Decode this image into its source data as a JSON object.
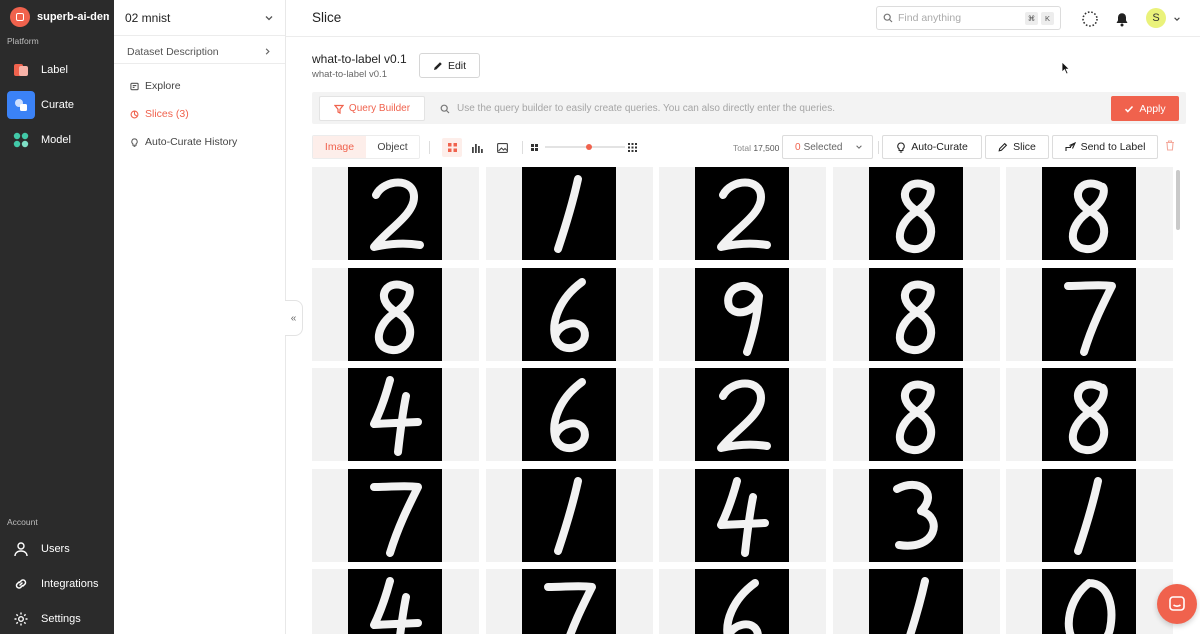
{
  "workspace": {
    "name": "superb-ai-demo"
  },
  "sidebar": {
    "platform_label": "Platform",
    "account_label": "Account",
    "platform_items": [
      {
        "label": "Label",
        "icon": "label-icon"
      },
      {
        "label": "Curate",
        "icon": "curate-icon",
        "active": true
      },
      {
        "label": "Model",
        "icon": "model-icon"
      }
    ],
    "account_items": [
      {
        "label": "Users",
        "icon": "user-icon"
      },
      {
        "label": "Integrations",
        "icon": "link-icon"
      },
      {
        "label": "Settings",
        "icon": "gear-icon"
      }
    ]
  },
  "subnav": {
    "project": "02 mnist",
    "dataset_description": "Dataset Description",
    "items": [
      {
        "label": "Explore",
        "icon": "explore-icon"
      },
      {
        "label": "Slices (3)",
        "icon": "slices-icon",
        "active": true
      },
      {
        "label": "Auto-Curate History",
        "icon": "bulb-icon"
      }
    ],
    "collapse_glyph": "«"
  },
  "header": {
    "title": "Slice",
    "search_placeholder": "Find anything",
    "shortcut_keys": [
      "⌘",
      "K"
    ],
    "avatar_initial": "S"
  },
  "slice": {
    "name": "what-to-label v0.1",
    "subname": "what-to-label v0.1",
    "edit_label": "Edit"
  },
  "query": {
    "builder_label": "Query Builder",
    "placeholder": "Use the query builder to easily create queries. You can also directly enter the queries.",
    "apply_label": "Apply"
  },
  "toolbar": {
    "view_modes": [
      "Image",
      "Object"
    ],
    "active_view_mode": "Image",
    "thumbnail_size_level": 0.55,
    "total_label": "Total",
    "total_value": "17,500",
    "selected_count": "0",
    "selected_label": "Selected",
    "auto_curate_label": "Auto-Curate",
    "slice_label": "Slice",
    "send_label": "Send to Label"
  },
  "grid": {
    "digits": [
      [
        2,
        1,
        2,
        8,
        8
      ],
      [
        8,
        6,
        9,
        8,
        7
      ],
      [
        4,
        6,
        2,
        8,
        8
      ],
      [
        7,
        1,
        4,
        3,
        1
      ],
      [
        4,
        7,
        6,
        1,
        0
      ]
    ]
  },
  "colors": {
    "accent": "#f0624d",
    "sidebar_bg": "#2b2b2b",
    "active_nav": "#3b82f6"
  }
}
